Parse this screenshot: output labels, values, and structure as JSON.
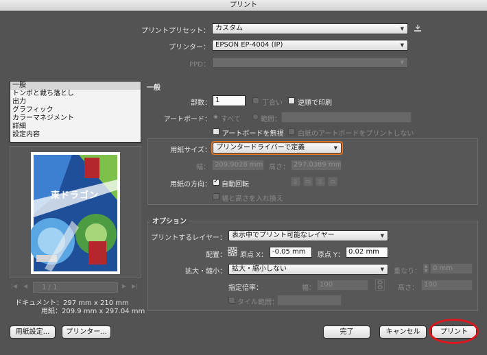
{
  "window": {
    "title": "プリント"
  },
  "top": {
    "preset_label": "プリントプリセット：",
    "preset_value": "カスタム",
    "printer_label": "プリンター：",
    "printer_value": "EPSON EP-4004 (IP)",
    "ppd_label": "PPD："
  },
  "sidebar": {
    "items": [
      {
        "label": "一般"
      },
      {
        "label": "トンボと裁ち落とし"
      },
      {
        "label": "出力"
      },
      {
        "label": "グラフィック"
      },
      {
        "label": "カラーマネジメント"
      },
      {
        "label": "詳細"
      },
      {
        "label": "設定内容"
      }
    ],
    "page_indicator": "1 / 1",
    "doc_info": "ドキュメント：297 mm x 210 mm",
    "paper_info": "用紙：209.9 mm x 297.04 mm",
    "preview_title": "東ドラゴン"
  },
  "general": {
    "section_title": "一般",
    "copies_label": "部数：",
    "copies_value": "1",
    "collate_label": "丁合い",
    "reverse_label": "逆順で印刷",
    "artboard_label": "アートボード：",
    "all_label": "すべて",
    "range_label": "範囲：",
    "ignore_artboards_label": "アートボードを無視",
    "skip_blank_label": "白紙のアートボードをプリントしない"
  },
  "paper": {
    "size_label": "用紙サイズ：",
    "size_value": "プリンタードライバーで定義",
    "width_label": "幅：",
    "width_value": "209.9028 mm",
    "height_label": "高さ：",
    "height_value": "297.0389 mm",
    "orientation_label": "用紙の方向：",
    "auto_rotate_label": "自動回転",
    "transverse_label": "幅と高さを入れ換え"
  },
  "options": {
    "section_title": "オプション",
    "layers_label": "プリントするレイヤー：",
    "layers_value": "表示中でプリント可能なレイヤー",
    "placement_label": "配置：",
    "origin_x_label": "原点 X：",
    "origin_x_value": "-0.05 mm",
    "origin_y_label": "原点 Y：",
    "origin_y_value": "0.02 mm",
    "scaling_label": "拡大・縮小：",
    "scaling_value": "拡大・縮小しない",
    "overlap_label": "重なり：",
    "overlap_value": "0 mm",
    "custom_scale_label": "指定倍率：",
    "scale_w_label": "幅：",
    "scale_w_value": "100",
    "scale_h_label": "高さ：",
    "scale_h_value": "100",
    "tile_label": "タイル範囲："
  },
  "buttons": {
    "page_setup": "用紙設定...",
    "printer": "プリンター...",
    "done": "完了",
    "cancel": "キャンセル",
    "print": "プリント"
  }
}
